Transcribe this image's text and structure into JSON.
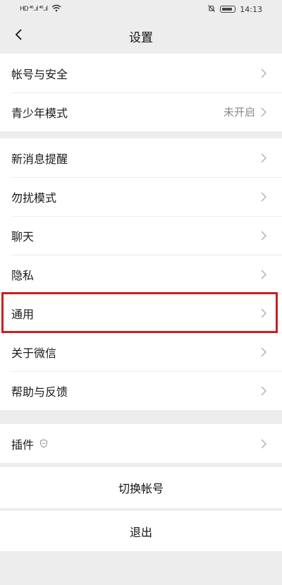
{
  "status_bar": {
    "left_glyphs": "HD ⁴⁶..ıl ⁴⁶..ıl",
    "time": "14:13"
  },
  "nav": {
    "title": "设置"
  },
  "group1": {
    "items": [
      {
        "label": "帐号与安全",
        "value": ""
      },
      {
        "label": "青少年模式",
        "value": "未开启"
      }
    ]
  },
  "group2": {
    "items": [
      {
        "label": "新消息提醒"
      },
      {
        "label": "勿扰模式"
      },
      {
        "label": "聊天"
      },
      {
        "label": "隐私"
      },
      {
        "label": "通用"
      },
      {
        "label": "关于微信"
      },
      {
        "label": "帮助与反馈"
      }
    ]
  },
  "group3": {
    "items": [
      {
        "label": "插件"
      }
    ]
  },
  "actions": {
    "switch_account": "切换帐号",
    "logout": "退出"
  },
  "colors": {
    "background": "#ededed",
    "highlight": "#c8201f",
    "secondary_text": "#888888"
  }
}
